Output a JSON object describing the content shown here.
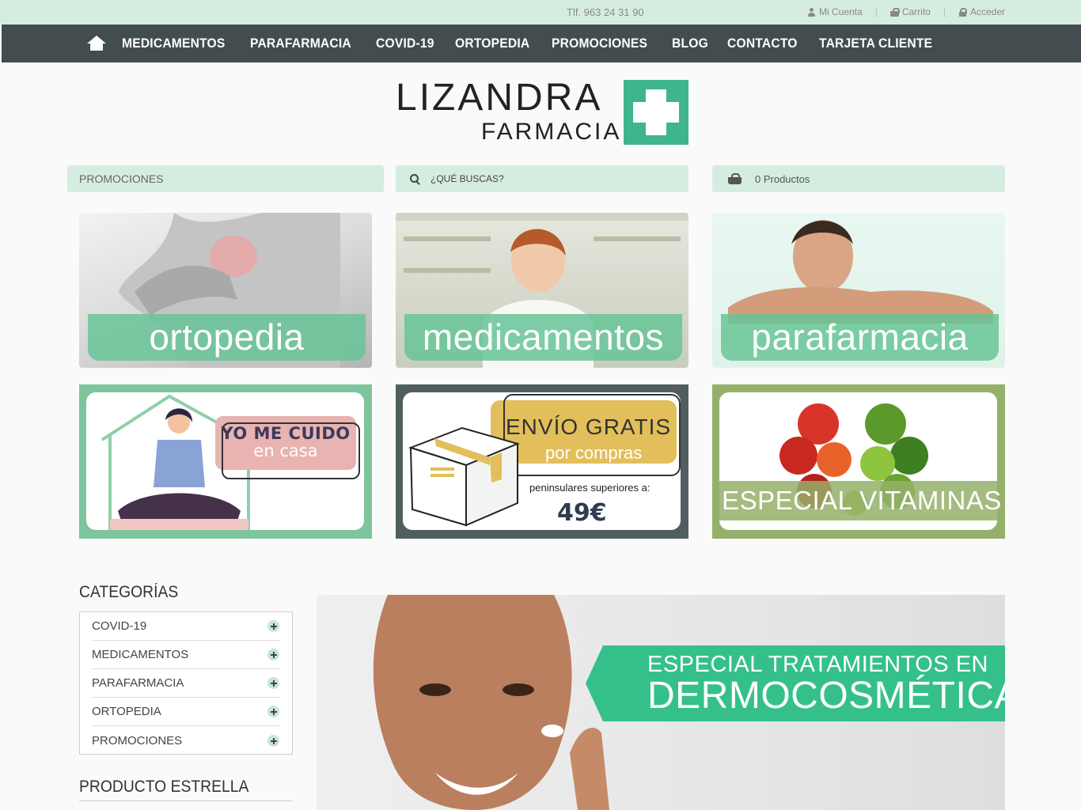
{
  "topbar": {
    "phone": "Tlf. 963 24 31 90",
    "account": "Mi Cuenta",
    "cart": "Carrito",
    "login": "Acceder"
  },
  "nav": {
    "items": [
      "MEDICAMENTOS",
      "PARAFARMACIA",
      "COVID-19",
      "ORTOPEDIA",
      "PROMOCIONES",
      "BLOG",
      "CONTACTO",
      "TARJETA CLIENTE"
    ]
  },
  "logo": {
    "line1": "LIZANDRA",
    "line2": "FARMACIA"
  },
  "search_row": {
    "category": "PROMOCIONES",
    "search_placeholder": "¿QUÉ BUSCAS?",
    "cart_summary": "0 Productos"
  },
  "tiles": [
    {
      "label": "ortopedia"
    },
    {
      "label": "medicamentos"
    },
    {
      "label": "parafarmacia"
    }
  ],
  "promos": {
    "yo_cuido": {
      "line1": "YO ME CUIDO",
      "line2": "en casa"
    },
    "envio": {
      "line1": "ENVÍO GRATIS",
      "line2": "por compras",
      "line3": "peninsulares superiores a:",
      "amount": "49€"
    },
    "vitaminas": {
      "label": "ESPECIAL VITAMINAS"
    }
  },
  "sidebar": {
    "categories_title": "CATEGORÍAS",
    "categories": [
      "COVID-19",
      "MEDICAMENTOS",
      "PARAFARMACIA",
      "ORTOPEDIA",
      "PROMOCIONES"
    ],
    "featured_title": "PRODUCTO ESTRELLA"
  },
  "banner": {
    "line1": "ESPECIAL TRATAMIENTOS EN",
    "line2": "DERMOCOSMÉTICA"
  },
  "colors": {
    "mint": "#d5ede1",
    "nav": "#434d4f",
    "brand_green": "#3eb58b"
  }
}
